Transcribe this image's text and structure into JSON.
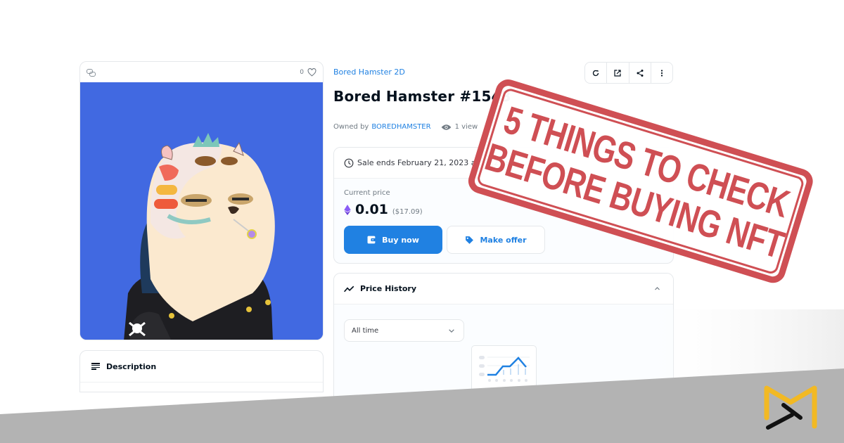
{
  "media": {
    "favorite_count": "0",
    "icons": {
      "chain": "chain-link-icon",
      "favorite": "heart-icon"
    },
    "image_alt": "Bored Hamster NFT artwork",
    "background_color": "#4169e1"
  },
  "description": {
    "label": "Description",
    "icon": "lines-icon"
  },
  "header": {
    "collection": "Bored Hamster 2D",
    "title": "Bored Hamster #1543",
    "owned_by_label": "Owned by",
    "owner": "BOREDHAMSTER",
    "views": "1 view",
    "toolbar": [
      "refresh-icon",
      "external-link-icon",
      "share-icon",
      "more-vertical-icon"
    ]
  },
  "sale": {
    "ends_text": "Sale ends February 21, 2023 at 10:29am",
    "current_price_label": "Current price",
    "price": "0.01",
    "price_usd": "($17.09)",
    "buy_label": "Buy now",
    "offer_label": "Make offer"
  },
  "history": {
    "label": "Price History",
    "range_value": "All time"
  },
  "stamp": {
    "line1": "5 THINGS TO CHECK",
    "line2": "BEFORE BUYING NFT",
    "color": "#cf4f54"
  },
  "colors": {
    "accent": "#2081e2",
    "band": "#b3b3b3",
    "logo_yellow": "#f2b924",
    "logo_black": "#111111"
  }
}
